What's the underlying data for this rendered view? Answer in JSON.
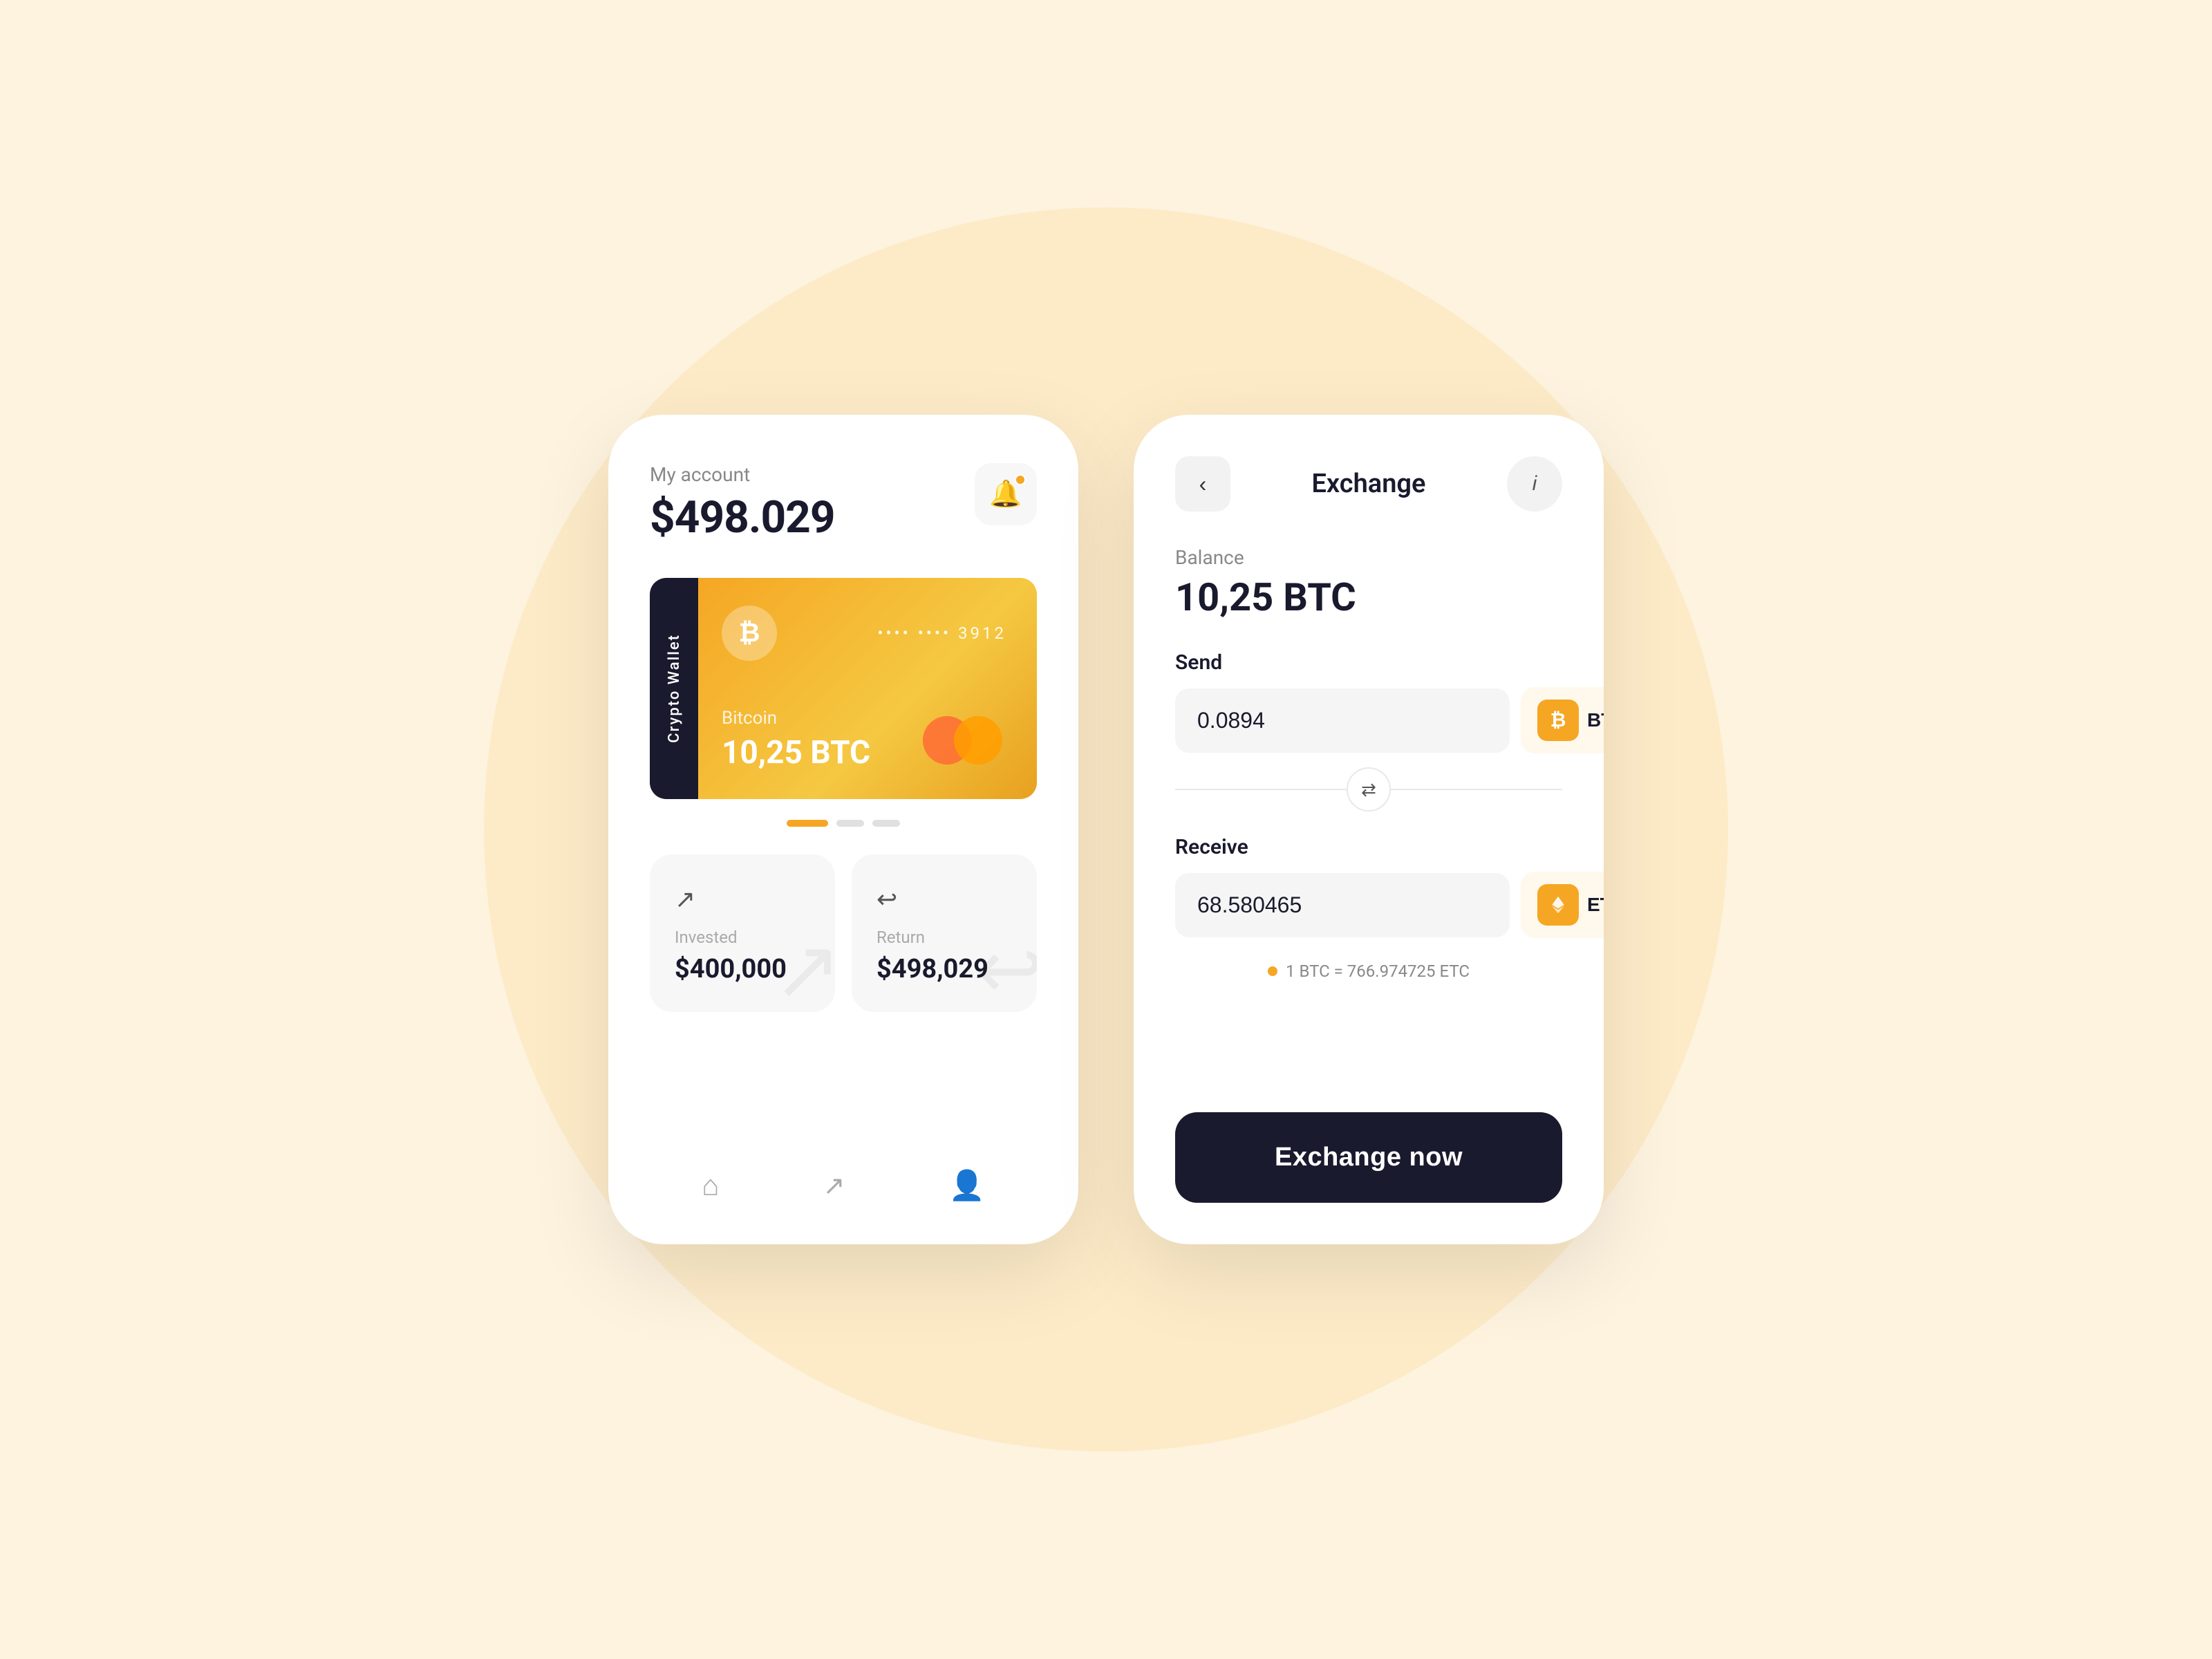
{
  "background": {
    "color": "#fdf3df"
  },
  "phone1": {
    "account_label": "My account",
    "account_balance": "$498.029",
    "bell_button_label": "notifications",
    "crypto_wallet_label": "Crypto Wallet",
    "card": {
      "masked_number": "•••• ••••  3912",
      "coin_name": "Bitcoin",
      "amount": "10,25 BTC"
    },
    "stats": {
      "invested_label": "Invested",
      "invested_value": "$400,000",
      "return_label": "Return",
      "return_value": "$498,029"
    },
    "nav": {
      "home_label": "home",
      "chart_label": "chart",
      "profile_label": "profile"
    }
  },
  "phone2": {
    "header": {
      "back_label": "‹",
      "title": "Exchange",
      "info_label": "ⓘ"
    },
    "balance_label": "Balance",
    "balance_amount": "10,25 BTC",
    "send_label": "Send",
    "send_amount": "0.0894",
    "send_coin": "BTC",
    "receive_label": "Receive",
    "receive_amount": "68.580465",
    "receive_coin": "ETC",
    "rate_text": "1 BTC = 766.974725 ETC",
    "exchange_now_label": "Exchange now"
  }
}
